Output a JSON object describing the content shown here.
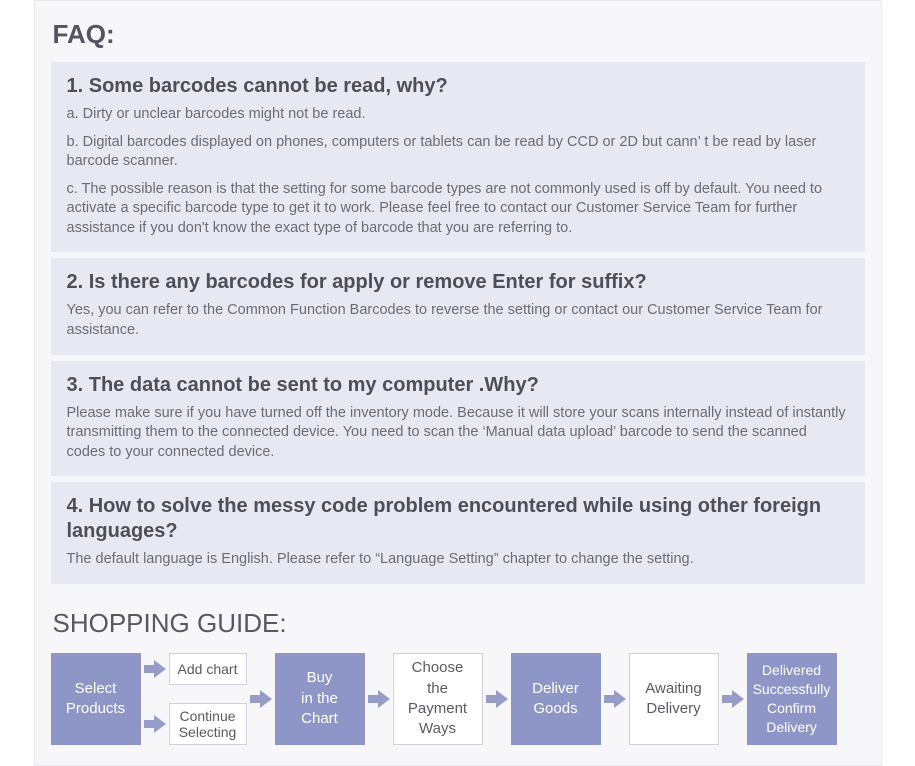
{
  "faq": {
    "title": "FAQ:",
    "items": [
      {
        "question": "1. Some barcodes cannot be read, why?",
        "answers": [
          "a. Dirty or unclear barcodes might not be read.",
          "b. Digital barcodes displayed on phones, computers or tablets can be read by CCD or 2D but cann’ t  be read by laser barcode scanner.",
          "c. The possible reason is that the setting for some barcode types are not commonly used is off by default. You need to activate a specific barcode type to get it to work. Please feel free to contact our Customer Service Team for further assistance if you don't know the exact type of barcode that you are referring to."
        ]
      },
      {
        "question": "2. Is there any barcodes for apply or remove Enter for suffix?",
        "answers": [
          "Yes, you can refer to the Common Function Barcodes to reverse the setting or contact our Customer Service Team for assistance."
        ]
      },
      {
        "question": "3. The data cannot be sent to my computer .Why?",
        "answers": [
          "Please make sure if you have turned off the inventory mode. Because it will store your scans internally instead of instantly transmitting them to the connected device. You need to scan the ‘Manual data upload’ barcode to send the scanned codes to your connected device."
        ]
      },
      {
        "question": "4. How to solve the messy code problem encountered while using other foreign languages?",
        "answers": [
          "The default language is English. Please refer to “Language Setting” chapter to change the setting."
        ]
      }
    ]
  },
  "guide": {
    "title": "SHOPPING GUIDE:",
    "steps": {
      "select_products": "Select Products",
      "add_chart": "Add chart",
      "continue_selecting_l1": "Continue",
      "continue_selecting_l2": "Selecting",
      "buy_l1": "Buy",
      "buy_l2": "in the",
      "buy_l3": "Chart",
      "payment_l1": "Choose the",
      "payment_l2": "Payment",
      "payment_l3": "Ways",
      "deliver_l1": "Deliver",
      "deliver_l2": "Goods",
      "await_l1": "Awaiting",
      "await_l2": "Delivery",
      "done_l1": "Delivered",
      "done_l2": "Successfully",
      "done_l3": "Confirm",
      "done_l4": "Delivery"
    }
  }
}
